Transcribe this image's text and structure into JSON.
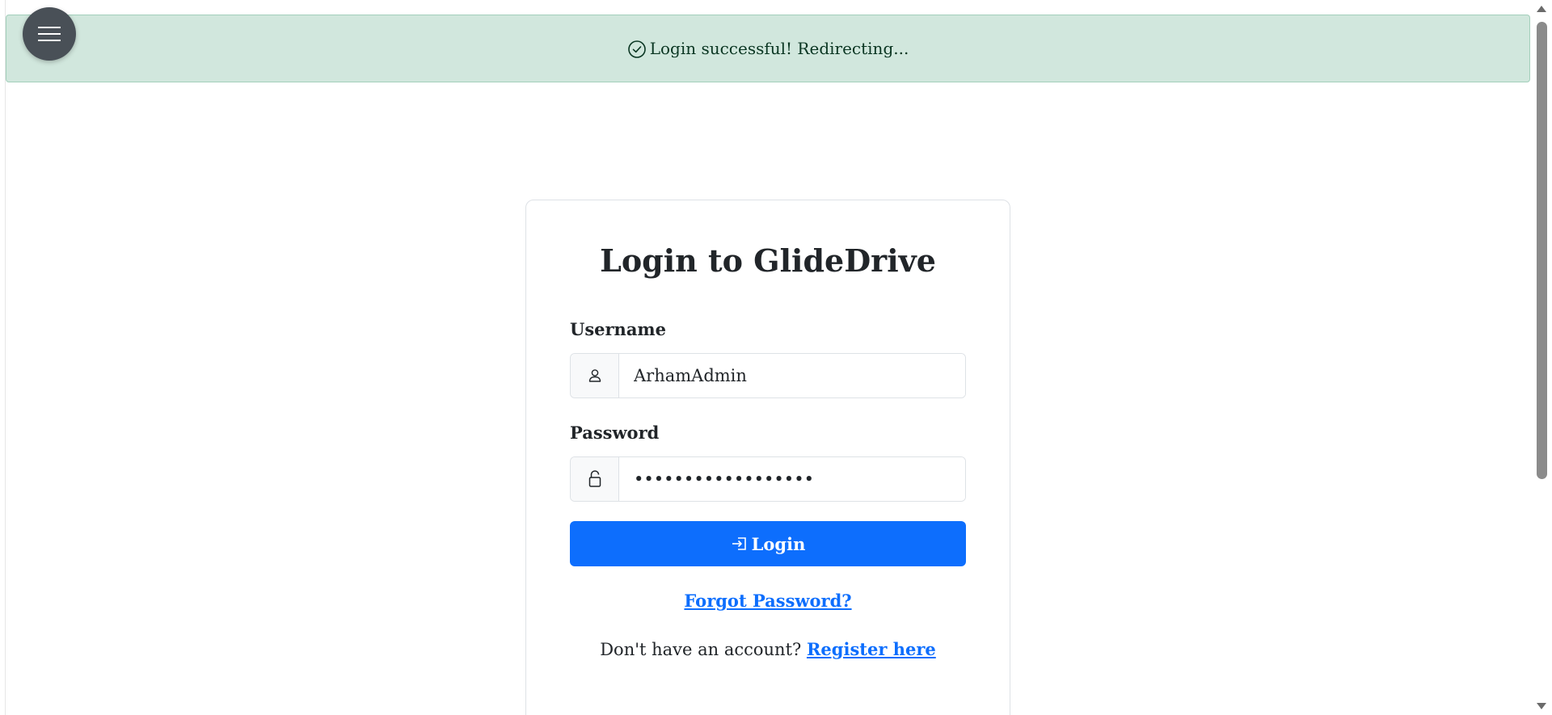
{
  "alert": {
    "message": "Login successful! Redirecting...",
    "icon": "check-circle-icon",
    "background": "#d1e7dd",
    "text_color": "#0a3622"
  },
  "menu": {
    "icon": "hamburger-icon",
    "color": "#495057"
  },
  "login_card": {
    "title": "Login to GlideDrive",
    "username": {
      "label": "Username",
      "value": "ArhamAdmin",
      "icon": "person-icon"
    },
    "password": {
      "label": "Password",
      "value": "••••••••••••••••••",
      "icon": "lock-icon"
    },
    "submit": {
      "label": "Login",
      "icon": "box-arrow-in-right-icon",
      "color": "#0d6efd"
    },
    "forgot_link": "Forgot Password?",
    "register_prompt": "Don't have an account?",
    "register_link": "Register here"
  }
}
